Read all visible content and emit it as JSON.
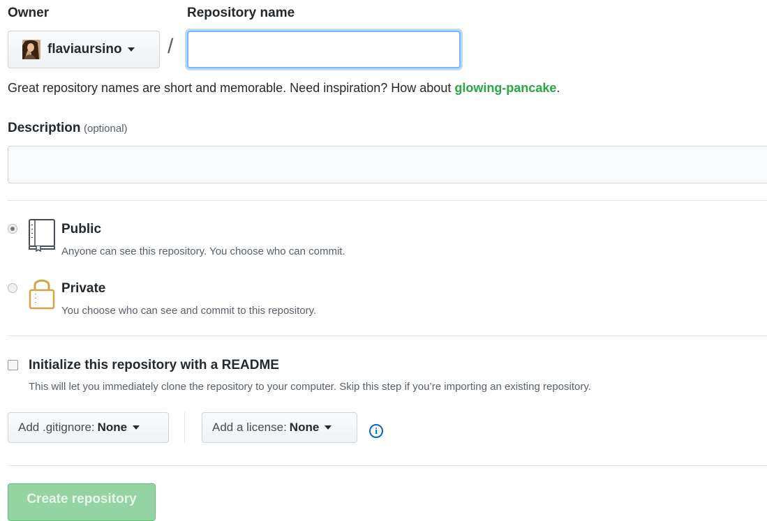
{
  "owner": {
    "label": "Owner",
    "username": "flaviaursino"
  },
  "repo": {
    "label": "Repository name",
    "value": "",
    "separator": "/"
  },
  "hint": {
    "text": "Great repository names are short and memorable. Need inspiration? How about ",
    "suggestion": "glowing-pancake",
    "end": "."
  },
  "description": {
    "label": "Description",
    "optional": "(optional)",
    "value": ""
  },
  "visibility": {
    "selected": "public",
    "public": {
      "title": "Public",
      "desc": "Anyone can see this repository. You choose who can commit."
    },
    "private": {
      "title": "Private",
      "desc": "You choose who can see and commit to this repository."
    }
  },
  "readme": {
    "checked": false,
    "title": "Initialize this repository with a README",
    "desc": "This will let you immediately clone the repository to your computer. Skip this step if you’re importing an existing repository."
  },
  "gitignore": {
    "prefix": "Add .gitignore:",
    "value": "None"
  },
  "license": {
    "prefix": "Add a license:",
    "value": "None"
  },
  "info_glyph": "i",
  "create_button": "Create repository",
  "colors": {
    "accent": "#0366d6",
    "suggest": "#28a745",
    "create_bg": "#94d3a2"
  },
  "icons": {
    "public": "repo-book-icon",
    "private": "lock-icon",
    "info": "info-icon"
  }
}
